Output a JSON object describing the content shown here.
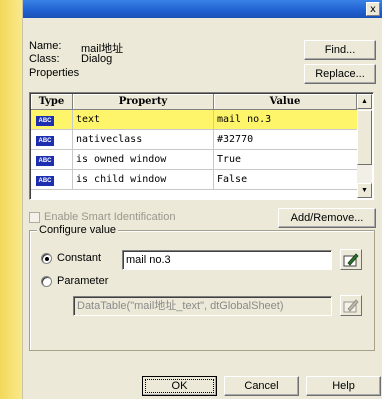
{
  "window": {
    "close_glyph": "x"
  },
  "header": {
    "name_label": "Name:",
    "name_value": "mail地址",
    "class_label": "Class:",
    "class_value": "Dialog",
    "properties_label": "Properties"
  },
  "buttons": {
    "find": "Find...",
    "replace": "Replace...",
    "add_remove": "Add/Remove...",
    "ok": "OK",
    "cancel": "Cancel",
    "help": "Help"
  },
  "table": {
    "columns": [
      "Type",
      "Property",
      "Value"
    ],
    "type_badge": "ABC",
    "rows": [
      {
        "property": "text",
        "value": "mail no.3",
        "selected": true
      },
      {
        "property": "nativeclass",
        "value": "#32770",
        "selected": false
      },
      {
        "property": "is owned window",
        "value": "True",
        "selected": false
      },
      {
        "property": "is child window",
        "value": "False",
        "selected": false
      }
    ]
  },
  "smart_identification": {
    "label": "Enable Smart Identification",
    "checked": false,
    "enabled": false
  },
  "configure": {
    "legend": "Configure value",
    "constant_label": "Constant",
    "constant_value": "mail no.3",
    "constant_selected": true,
    "parameter_label": "Parameter",
    "parameter_value": "DataTable(\"mail地址_text\", dtGlobalSheet)"
  },
  "colors": {
    "selected_row": "#fff56a",
    "title_bar": "#1f5fcf",
    "abc_badge": "#1d2fb0",
    "dialog_bg": "#ece9d8"
  }
}
